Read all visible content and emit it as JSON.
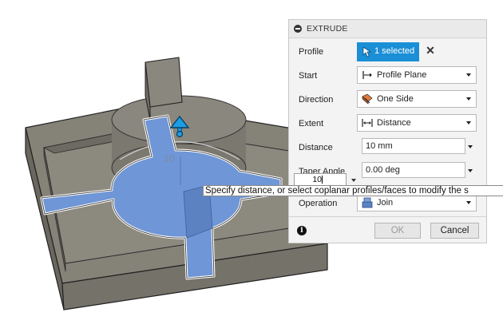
{
  "dialog": {
    "title": "EXTRUDE",
    "rows": {
      "profile": {
        "label": "Profile",
        "value": "1 selected"
      },
      "start": {
        "label": "Start",
        "value": "Profile Plane",
        "icon": "profile-plane-icon"
      },
      "direction": {
        "label": "Direction",
        "value": "One Side",
        "icon": "one-side-icon"
      },
      "extent": {
        "label": "Extent",
        "value": "Distance",
        "icon": "distance-extent-icon"
      },
      "distance": {
        "label": "Distance",
        "value": "10 mm"
      },
      "taper": {
        "label": "Taper Angle",
        "value": "0.00 deg"
      },
      "operation": {
        "label": "Operation",
        "value": "Join",
        "icon": "join-icon"
      }
    },
    "ok_label": "OK",
    "cancel_label": "Cancel",
    "accent": "#1b8fd6"
  },
  "canvas": {
    "value_input": "10",
    "dimension_text": "10",
    "tooltip": "Specify distance, or select coplanar profiles/faces to modify the s",
    "colors": {
      "body_top": "#858278",
      "body_side": "#6a675f",
      "selection": "#6f96d6",
      "manipulator": "#1b9ee6"
    }
  }
}
